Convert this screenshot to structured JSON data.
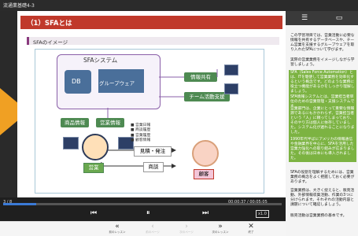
{
  "app": {
    "title": "流通業基礎4-3"
  },
  "slide": {
    "heading": "（1）SFAとは",
    "subheading": "SFAのイメージ",
    "system_title": "SFAシステム",
    "db_label": "DB",
    "groupware_label": "グループウェア",
    "info_share": "情報共有",
    "team_support": "チーム活動支援",
    "product_info": "商品情報",
    "sales_info": "営業情報",
    "list_items": [
      "■ 営業日報",
      "■ 商談履歴",
      "■ 営業履歴",
      "■ 顧客情報"
    ],
    "estimate_order": "見積・発注",
    "negotiation": "商談",
    "sales_person": "営業",
    "customer": "顧客",
    "copyright": "Copyright © 2020 Nippon Consultants Group, Inc. All Rights Reserved."
  },
  "player": {
    "page": "3 / 8",
    "time": "00:00:37 / 00:05:05",
    "speed": "x1.0",
    "progress_fraction": 0.12
  },
  "bottom": {
    "prev_lesson": "前のレッスン",
    "prev_page": "前のページ",
    "next_page": "次のページ",
    "next_lesson": "次のレッスン",
    "end": "終了"
  },
  "notes": {
    "p1": "この学習項目では、営業活動に必要な情報を共有するデータベースや、チーム営業を支援するグループウェアを取り入れたSFAについて学びます。",
    "p2": "実際の営業業務をイメージしながら学習しましょう。",
    "p3": "SFA（Sales Force Automation）とは、ITを駆使して営業業務を効率化するという概念です。どのような業務に役立つ機能があるかをしっかり理解しましょう。",
    "p4": "SFA情報システムとは、営業担当者単位のための営業管理・支援システムです。",
    "p5": "営業部門は、企業にとって重要な情報源であるにもかかわらず、営業担当者という「人」に頼ってしまっており、そのやり方は個人に依存していました。システム化が遅れることになりました。",
    "p6": "1990年代半ばにアメリカの情報通信や金融業界を中心に、SFAを活用した営業力強化への取り組みが広まりました。その後は日本にも導入されました。",
    "p7": "SFAの役割を理解するためには、営業業務の概念をよく把握しておく必要があります。",
    "p8": "営業業務は、大きく捉えると、販売活動、外部情報収集活動、作業の3つに分けられます。それぞれの活動内容と課題について確認しましょう。",
    "p9": "販売活動は営業業務の基本です。"
  },
  "colors": {
    "accent": "#c0392b",
    "green": "#4e8a52",
    "note_green": "#7cb342",
    "purple": "#8a5fa8",
    "orange": "#f0a023"
  }
}
